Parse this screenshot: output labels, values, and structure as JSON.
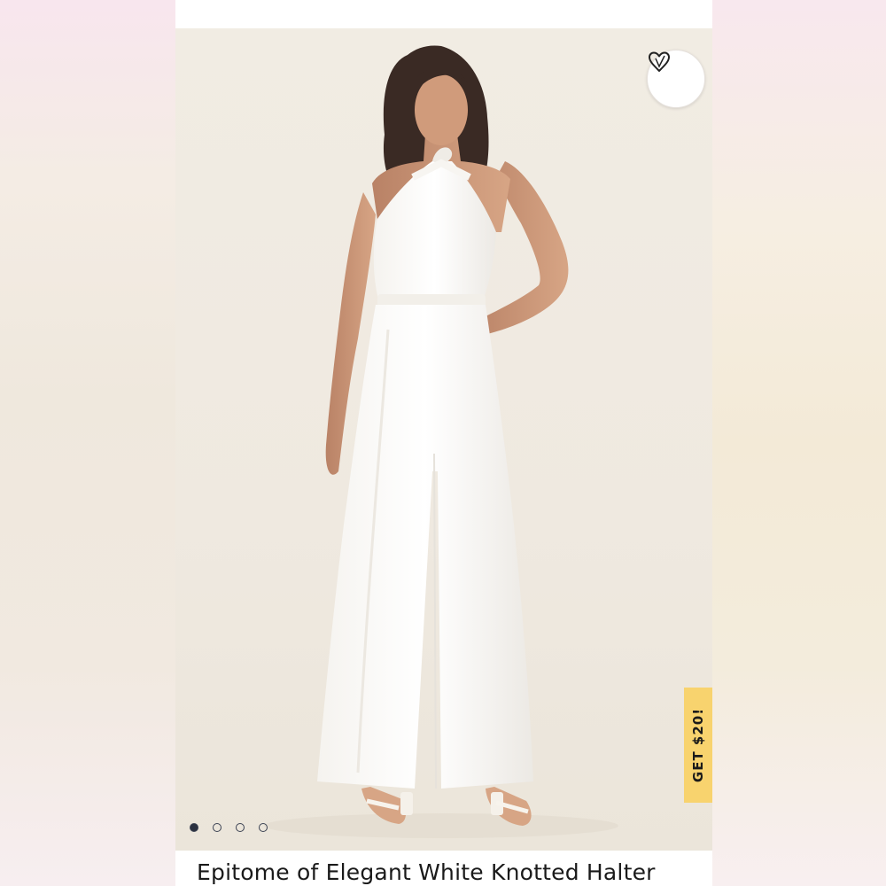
{
  "product": {
    "title": "Epitome of Elegant White Knotted Halter"
  },
  "gallery": {
    "image_count": 4,
    "active_index": 0,
    "favorite_icon": "heart-outline-icon"
  },
  "promo": {
    "label": "GET $20!",
    "color": "#f8d36e"
  }
}
